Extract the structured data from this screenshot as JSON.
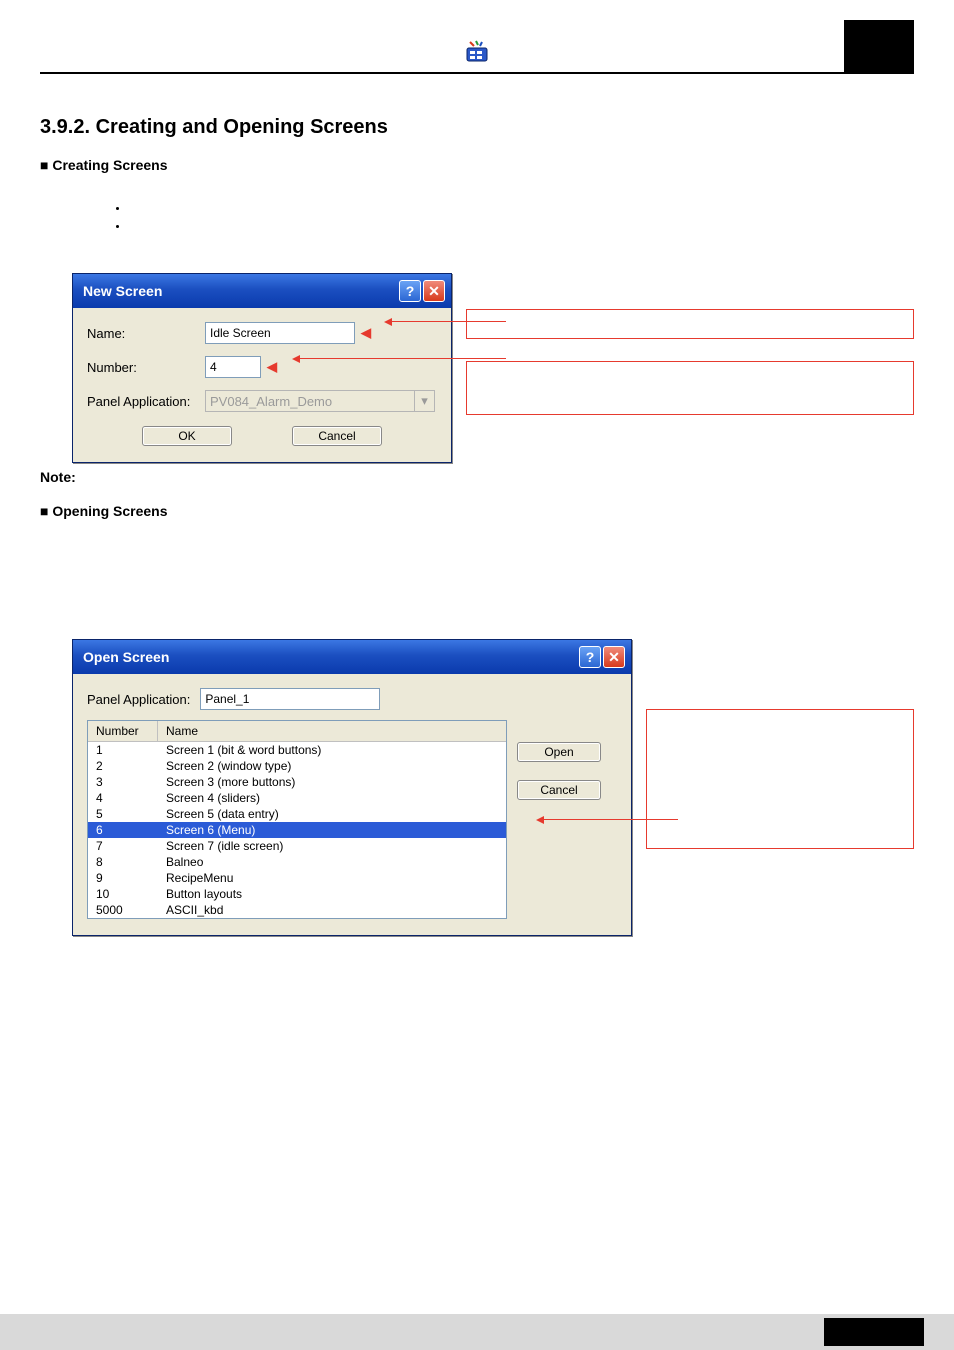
{
  "section": {
    "number": "3.9.2.",
    "title": "Creating and Opening Screens",
    "sub_creating": "■ Creating Screens",
    "note_label": "Note:",
    "sub_opening": "■ Opening Screens"
  },
  "new_screen_dialog": {
    "title": "New Screen",
    "labels": {
      "name": "Name:",
      "number": "Number:",
      "panel_app": "Panel Application:"
    },
    "values": {
      "name": "Idle Screen",
      "number": "4",
      "panel_app": "PV084_Alarm_Demo"
    },
    "buttons": {
      "ok": "OK",
      "cancel": "Cancel"
    }
  },
  "open_screen_dialog": {
    "title": "Open Screen",
    "labels": {
      "panel_app": "Panel Application:",
      "col_number": "Number",
      "col_name": "Name"
    },
    "values": {
      "panel_app": "Panel_1"
    },
    "rows": [
      {
        "num": "1",
        "name": "Screen 1 (bit & word buttons)"
      },
      {
        "num": "2",
        "name": "Screen 2 (window type)"
      },
      {
        "num": "3",
        "name": "Screen 3 (more buttons)"
      },
      {
        "num": "4",
        "name": "Screen 4 (sliders)"
      },
      {
        "num": "5",
        "name": "Screen 5 (data entry)"
      },
      {
        "num": "6",
        "name": "Screen 6 (Menu)"
      },
      {
        "num": "7",
        "name": "Screen 7 (idle screen)"
      },
      {
        "num": "8",
        "name": "Balneo"
      },
      {
        "num": "9",
        "name": "RecipeMenu"
      },
      {
        "num": "10",
        "name": "Button layouts"
      },
      {
        "num": "5000",
        "name": "ASCII_kbd"
      }
    ],
    "selected_index": 5,
    "buttons": {
      "open": "Open",
      "cancel": "Cancel"
    }
  }
}
